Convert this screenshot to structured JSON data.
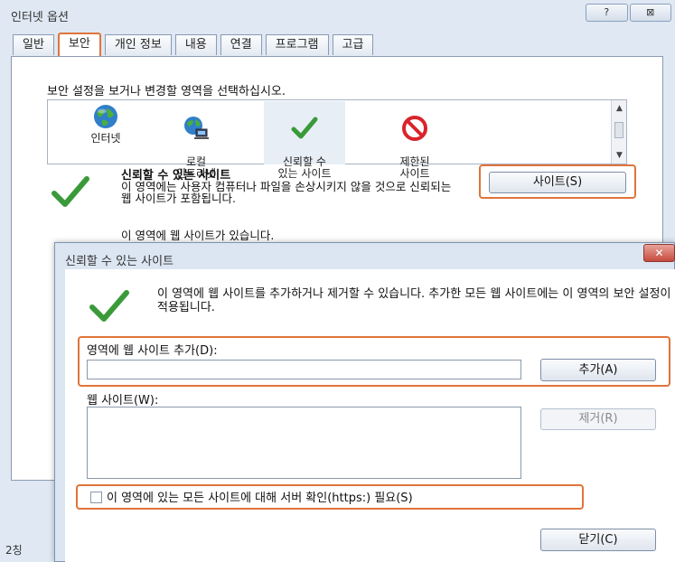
{
  "window": {
    "title": "인터넷 옵션",
    "help_glyph": "?",
    "close_glyph": "⊠"
  },
  "tabs": [
    {
      "label": "일반"
    },
    {
      "label": "보안",
      "active": true
    },
    {
      "label": "개인 정보"
    },
    {
      "label": "내용"
    },
    {
      "label": "연결"
    },
    {
      "label": "프로그램"
    },
    {
      "label": "고급"
    }
  ],
  "security": {
    "instruction": "보안 설정을 보거나 변경할 영역을 선택하십시오.",
    "zones": [
      {
        "label": "인터넷",
        "icon": "globe-icon"
      },
      {
        "label": "로컬\n인트라넷",
        "icon": "intranet-icon"
      },
      {
        "label": "신뢰할 수\n있는 사이트",
        "icon": "checkmark-icon",
        "selected": true
      },
      {
        "label": "제한된\n사이트",
        "icon": "no-entry-icon"
      }
    ],
    "zone_title": "신뢰할 수 있는 사이트",
    "zone_desc": "이 영역에는 사용자 컴퓨터나 파일을 손상시키지 않을 것으로 신뢰되는 웹 사이트가 포함됩니다.",
    "zone_note": "이 영역에 웹 사이트가 있습니다.",
    "sites_button": "사이트(S)"
  },
  "dialog": {
    "title": "신뢰할 수 있는 사이트",
    "close_glyph": "✕",
    "info": "이 영역에 웹 사이트를 추가하거나 제거할 수 있습니다. 추가한 모든 웹 사이트에는 이 영역의 보안 설정이 적용됩니다.",
    "add_label": "영역에 웹 사이트 추가(D):",
    "add_value": "",
    "add_button": "추가(A)",
    "sites_label": "웹 사이트(W):",
    "sites": [],
    "remove_button": "제거(R)",
    "https_label": "이 영역에 있는 모든 사이트에 대해 서버 확인(https:) 필요(S)",
    "https_checked": false,
    "close_button": "닫기(C)"
  },
  "background": {
    "cut_text": "2칭"
  },
  "colors": {
    "highlight": "#e0743a",
    "check_green": "#3a9a3a",
    "no_entry_red": "#d9242b"
  }
}
